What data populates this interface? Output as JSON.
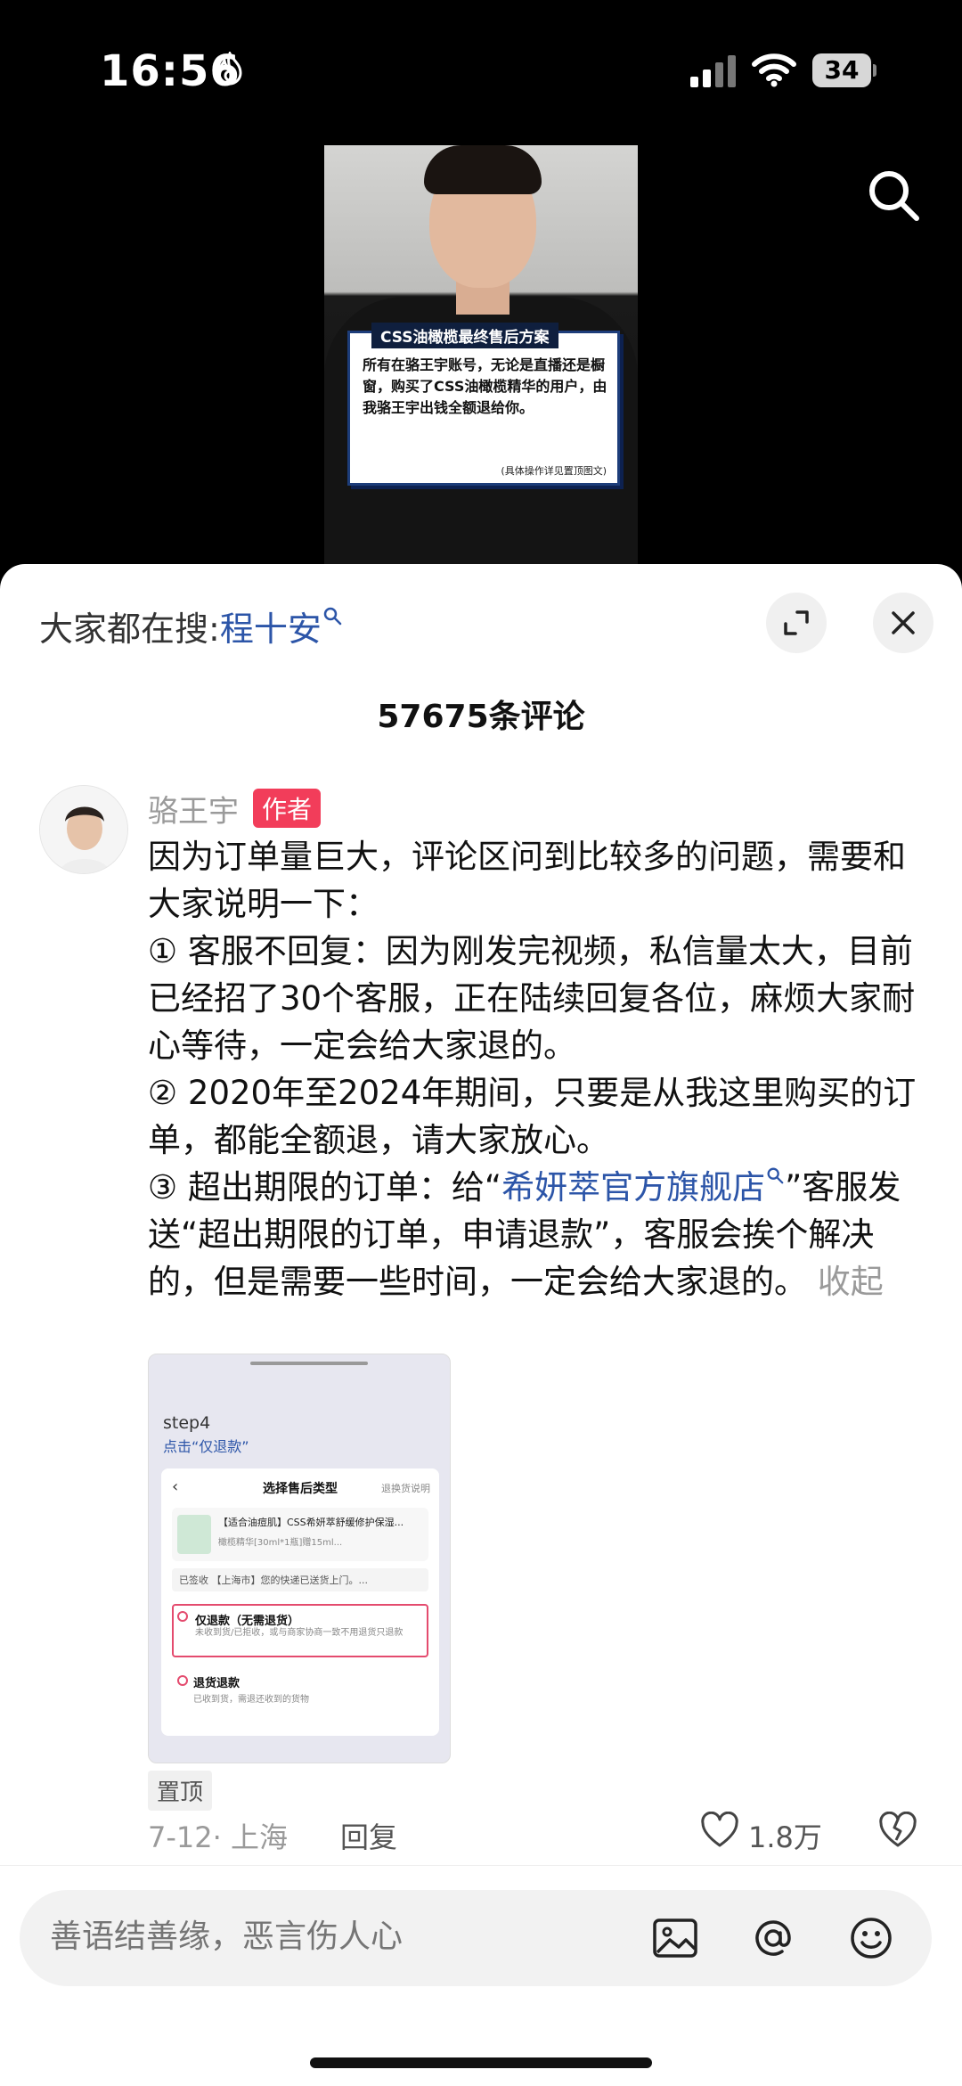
{
  "status_bar": {
    "time": "16:56",
    "battery_level": "34"
  },
  "video": {
    "overlay_title": "CSS油橄榄最终售后方案",
    "overlay_body": "所有在骆王宇账号，无论是直播还是橱窗，购买了CSS油橄榄精华的用户，由我骆王宇出钱全额退给你。",
    "overlay_note": "(具体操作详见置顶图文)"
  },
  "sheet": {
    "hot_search_label": "大家都在搜:",
    "hot_search_term": "程十安",
    "comment_count": "57675条评论"
  },
  "comment": {
    "author": "骆王宇",
    "author_badge": "作者",
    "p1": "因为订单量巨大，评论区问到比较多的问题，需要和大家说明一下：",
    "p2": "① 客服不回复：因为刚发完视频，私信量太大，目前已经招了30个客服，正在陆续回复各位，麻烦大家耐心等待，一定会给大家退的。",
    "p3": "②  2020年至2024年期间，只要是从我这里购买的订单，都能全额退，请大家放心。",
    "p4_prefix": "③ 超出期限的订单：给“",
    "p4_link": "希妍萃官方旗舰店",
    "p4_suffix": "”客服发送“超出期限的订单，申请退款”，客服会挨个解决的，但是需要一些时间，一定会给大家退的。",
    "collapse_label": "收起",
    "pin_badge": "置顶",
    "date_location": "7-12· 上海",
    "reply_label": "回复",
    "like_count": "1.8万"
  },
  "thumbnail": {
    "step": "step4",
    "step_sub": "点击“仅退款”",
    "panel_title": "选择售后类型",
    "panel_right": "退换货说明",
    "product_name": "【适合油痘肌】CSS希妍萃舒缓修护保湿...",
    "product_spec": "橄榄精华[30ml*1瓶]赠15ml...",
    "shipping": "已签收 【上海市】您的快递已送货上门。...",
    "option1_title": "仅退款（无需退货）",
    "option1_desc": "未收到货/已拒收，或与商家协商一致不用退货只退款",
    "option2_title": "退货退款",
    "option2_desc": "已收到货，需退还收到的货物"
  },
  "input_bar": {
    "placeholder": "善语结善缘，恶言伤人心"
  },
  "icons": {
    "search": "search-icon",
    "expand": "expand-icon",
    "close": "close-icon",
    "like": "heart-icon",
    "dislike": "broken-heart-icon",
    "image": "image-icon",
    "at": "at-icon",
    "emoji": "emoji-icon"
  },
  "colors": {
    "link": "#2c55a8",
    "author_badge": "#f23d5a",
    "muted": "#9a9a9a"
  }
}
